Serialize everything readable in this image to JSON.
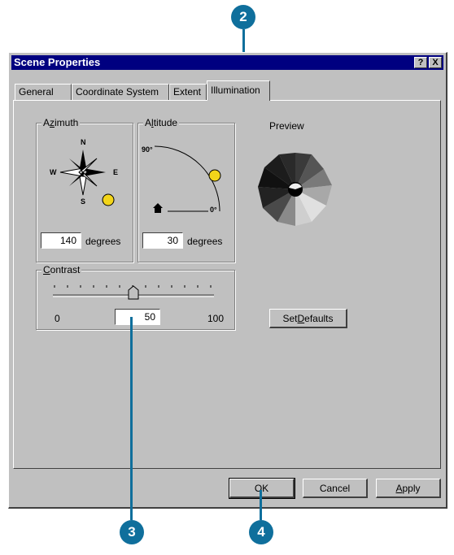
{
  "callouts": [
    "2",
    "3",
    "4"
  ],
  "colors": {
    "callout": "#0f6f9c",
    "titlebar": "#000080",
    "dialog": "#c0c0c0",
    "sun": "#f3d51a"
  },
  "dialog": {
    "title": "Scene Properties",
    "help_label": "?",
    "close_label": "X",
    "tabs": [
      "General",
      "Coordinate System",
      "Extent",
      "Illumination"
    ],
    "active_tab": "Illumination"
  },
  "azimuth": {
    "label_prefix": "A",
    "label_access": "z",
    "label_rest": "imuth",
    "compass": {
      "n": "N",
      "s": "S",
      "e": "E",
      "w": "W"
    },
    "value": "140",
    "unit": "degrees"
  },
  "altitude": {
    "label_prefix": "A",
    "label_access": "l",
    "label_rest": "titude",
    "max_label": "90°",
    "min_label": "0°",
    "value": "30",
    "unit": "degrees"
  },
  "preview": {
    "label": "Preview"
  },
  "contrast": {
    "label_access": "C",
    "label_rest": "ontrast",
    "min": "0",
    "max": "100",
    "value": "50",
    "slider_fraction": 0.5
  },
  "buttons": {
    "set_defaults_prefix": "Set ",
    "set_defaults_access": "D",
    "set_defaults_rest": "efaults",
    "ok": "OK",
    "cancel": "Cancel",
    "apply_access": "A",
    "apply_rest": "pply"
  }
}
